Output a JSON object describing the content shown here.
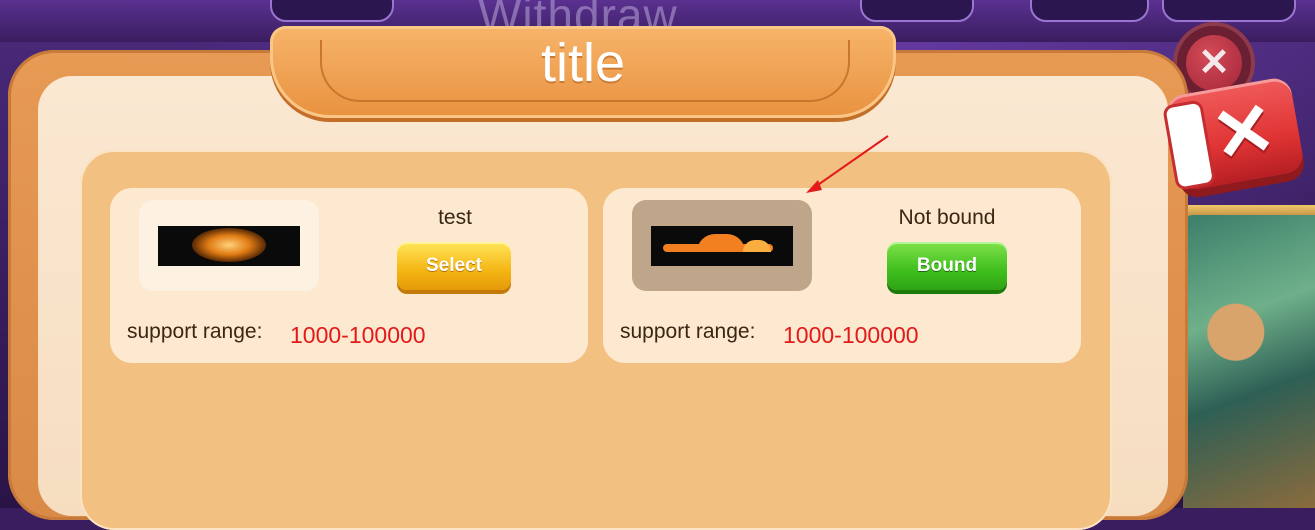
{
  "background": {
    "title": "Withdraw"
  },
  "dialog": {
    "title": "title",
    "cards": [
      {
        "status": "test",
        "button_label": "Select",
        "range_label": "support range:",
        "range_value": "1000-100000"
      },
      {
        "status": "Not bound",
        "button_label": "Bound",
        "range_label": "support range:",
        "range_value": "1000-100000"
      }
    ]
  },
  "colors": {
    "accent": "#e21a1a",
    "select": "#f4b514",
    "bound": "#3fbf1e",
    "frame": "#e08f45"
  },
  "icons": {
    "close": "close-icon",
    "logo_a": "lightbulb-logo-icon",
    "logo_b": "cloudflare-logo-icon"
  }
}
